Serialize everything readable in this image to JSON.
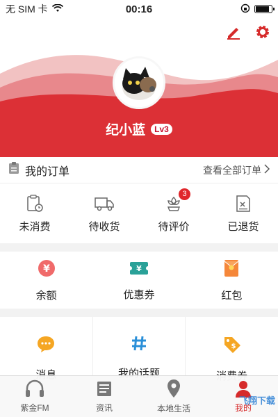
{
  "status_bar": {
    "carrier": "无 SIM 卡",
    "time": "00:16"
  },
  "profile": {
    "username": "纪小蓝",
    "level": "Lv3"
  },
  "orders": {
    "title": "我的订单",
    "view_all": "查看全部订单",
    "items": [
      {
        "label": "未消费",
        "icon": "clipboard-clock-icon"
      },
      {
        "label": "待收货",
        "icon": "truck-icon"
      },
      {
        "label": "待评价",
        "icon": "flower-icon",
        "badge": "3"
      },
      {
        "label": "已退货",
        "icon": "return-doc-icon"
      }
    ]
  },
  "wallet": [
    {
      "label": "余额",
      "icon": "yen-coin-icon"
    },
    {
      "label": "优惠券",
      "icon": "coupon-ticket-icon"
    },
    {
      "label": "红包",
      "icon": "red-envelope-icon"
    }
  ],
  "services": [
    {
      "label": "消息",
      "icon": "chat-bubble-icon"
    },
    {
      "label": "我的话题",
      "icon": "hashtag-icon"
    },
    {
      "label": "消费券",
      "icon": "price-tag-icon"
    }
  ],
  "tabs": [
    {
      "label": "紫金FM",
      "icon": "headphones-icon"
    },
    {
      "label": "资讯",
      "icon": "newspaper-icon"
    },
    {
      "label": "本地生活",
      "icon": "location-pin-icon"
    },
    {
      "label": "我的",
      "icon": "person-icon",
      "active": true
    }
  ],
  "watermark": "飞翔下载",
  "colors": {
    "brand_red": "#d62b2b",
    "wave_light": "#f0b3b3",
    "accent_orange": "#f5a623",
    "accent_teal": "#2aa198"
  }
}
